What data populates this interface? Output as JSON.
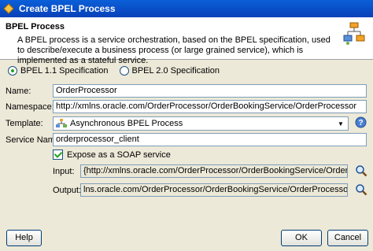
{
  "window": {
    "title": "Create BPEL Process"
  },
  "header": {
    "title": "BPEL Process",
    "description": "A BPEL process is a service orchestration, based on the BPEL specification, used to describe/execute a business process (or large grained service), which is implemented as a stateful service."
  },
  "spec": {
    "option1": "BPEL 1.1 Specification",
    "option2": "BPEL 2.0 Specification",
    "selected": "BPEL 1.1 Specification"
  },
  "form": {
    "name_label": "Name:",
    "name_value": "OrderProcessor",
    "namespace_label": "Namespace:",
    "namespace_value": "http://xmlns.oracle.com/OrderProcessor/OrderBookingService/OrderProcessor",
    "template_label": "Template:",
    "template_value": "Asynchronous BPEL Process",
    "service_name_label": "Service Name:",
    "service_name_value": "orderprocessor_client",
    "expose_label": "Expose as a SOAP service",
    "expose_checked": true,
    "input_label": "Input:",
    "input_value": "{http://xmlns.oracle.com/OrderProcessor/OrderBookingService/OrderProcessor}process",
    "output_label": "Output:",
    "output_value": "lns.oracle.com/OrderProcessor/OrderBookingService/OrderProcessor}processResponse"
  },
  "buttons": {
    "help": "Help",
    "ok": "OK",
    "cancel": "Cancel"
  },
  "icons": {
    "title": "oracle-jdev-icon",
    "header": "bpel-process-icon",
    "template": "bpel-template-icon",
    "help": "help-icon",
    "search": "magnifier-icon"
  }
}
